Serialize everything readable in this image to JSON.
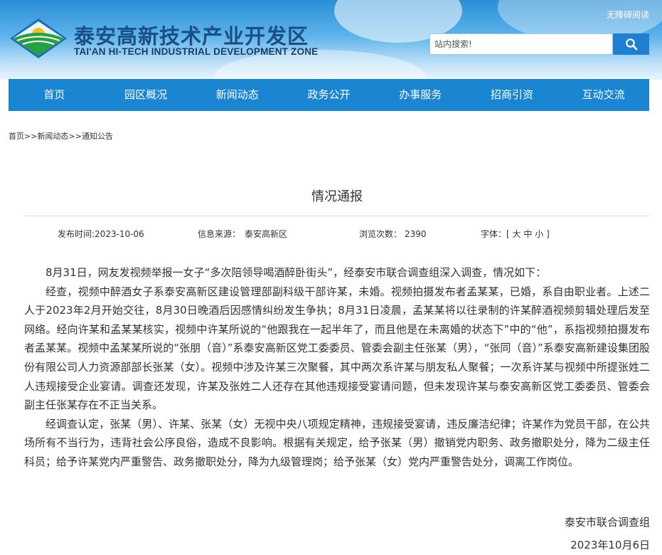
{
  "header": {
    "accessibility_link": "无障碍阅读",
    "site_title": "泰安高新技术产业开发区",
    "site_subtitle": "TAI'AN HI-TECH INDUSTRIAL DEVELOPMENT ZONE",
    "search_placeholder": "站内搜索!",
    "search_icon": "search-icon"
  },
  "nav": {
    "items": [
      "首页",
      "园区概况",
      "新闻动态",
      "政务公开",
      "办事服务",
      "招商引资",
      "互动交流"
    ]
  },
  "breadcrumb": {
    "home": "首页",
    "sep1": ">>",
    "news": "新闻动态",
    "sep2": ">>",
    "notice": "通知公告"
  },
  "article": {
    "title": "情况通报",
    "meta": {
      "date_label": "发布时间:",
      "date": "2023-10-06",
      "source_label": "信息来源：",
      "source": "泰安高新区",
      "views_label": "浏览次数：",
      "views": "2390",
      "font_label": "字体：",
      "font_open": "[",
      "font_large": "大",
      "font_medium": "中",
      "font_small": "小",
      "font_close": "]"
    },
    "paragraphs": [
      "8月31日，网友发视频举报一女子“多次陪领导喝酒醉卧街头”，经泰安市联合调查组深入调查，情况如下：",
      "经查，视频中醉酒女子系泰安高新区建设管理部副科级干部许某，未婚。视频拍摄发布者孟某某，已婚，系自由职业者。上述二人于2023年2月开始交往，8月30日晚酒后因感情纠纷发生争执；8月31日凌晨，孟某某将以往录制的许某醉酒视频剪辑处理后发至网络。经向许某和孟某某核实，视频中许某所说的“他跟我在一起半年了，而且他是在未离婚的状态下”中的“他”，系指视频拍摄发布者孟某某。视频中孟某某所说的“张朋（音）”系泰安高新区党工委委员、管委会副主任张某（男），“张同（音）”系泰安高新建设集团股份有限公司人力资源部部长张某（女）。视频中涉及许某三次聚餐，其中两次系许某与朋友私人聚餐；一次系许某与视频中所提张姓二人违规接受企业宴请。调查还发现，许某及张姓二人还存在其他违规接受宴请问题，但未发现许某与泰安高新区党工委委员、管委会副主任张某存在不正当关系。",
      "经调查认定，张某（男）、许某、张某（女）无视中央八项规定精神，违规接受宴请，违反廉洁纪律；许某作为党员干部，在公共场所有不当行为，违背社会公序良俗，造成不良影响。根据有关规定，给予张某（男）撤销党内职务、政务撤职处分，降为二级主任科员；给予许某党内严重警告、政务撤职处分，降为九级管理岗；给予张某（女）党内严重警告处分，调离工作岗位。"
    ],
    "signature": "泰安市联合调查组",
    "sign_date": "2023年10月6日"
  },
  "colors": {
    "nav_bg": "#1a85d1",
    "search_button": "#1f7fd0",
    "title_blue": "#1a4f86"
  }
}
